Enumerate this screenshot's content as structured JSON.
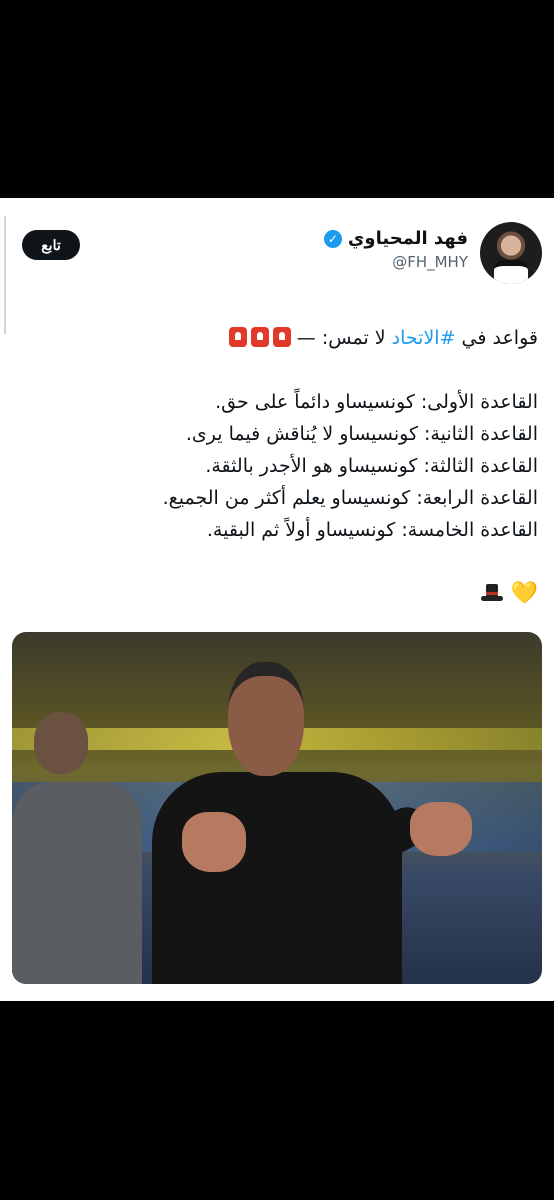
{
  "tweet": {
    "author": {
      "display_name": "فهد المحياوي",
      "handle": "@FH_MHY",
      "verified_icon": "✓",
      "avatar_icon": "avatar"
    },
    "follow_label": "تابع",
    "headline_prefix": "قواعد في ",
    "hashtag": "#الاتحاد",
    "headline_suffix": " لا تمس:",
    "headline_dash": "—",
    "rules": [
      "القاعدة الأولى: كونسيساو دائماً على حق.",
      "القاعدة الثانية: كونسيساو لا يُناقش فيما يرى.",
      "القاعدة الثالثة: كونسيساو هو الأجدر بالثقة.",
      "القاعدة الرابعة: كونسيساو يعلم أكثر من الجميع.",
      "القاعدة الخامسة: كونسيساو أولاً ثم البقية."
    ],
    "emoji_heart": "💛",
    "colors": {
      "accent": "#1d9bf0",
      "follow_bg": "#0f1419",
      "text": "#0f1419",
      "secondary": "#536471"
    }
  }
}
